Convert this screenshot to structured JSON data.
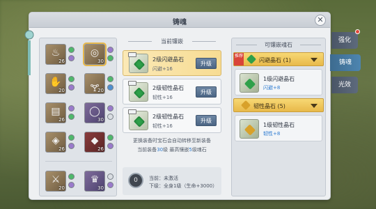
{
  "window": {
    "title": "铸魂",
    "close_glyph": "✕"
  },
  "equipment": [
    {
      "glyph": "♨",
      "lvl": "26",
      "color": "gold",
      "gems": [
        "g",
        "p"
      ]
    },
    {
      "glyph": "◎",
      "lvl": "30",
      "color": "gold",
      "gems": [
        "p",
        "g"
      ],
      "selected": true
    },
    {
      "glyph": "✋",
      "lvl": "20",
      "color": "gold",
      "gems": [
        "g",
        "p"
      ]
    },
    {
      "glyph": "🝖",
      "lvl": "20",
      "color": "gold",
      "gems": [
        "g",
        "b"
      ]
    },
    {
      "glyph": "▤",
      "lvl": "26",
      "color": "gold",
      "gems": [
        "p",
        "g"
      ]
    },
    {
      "glyph": "◯",
      "lvl": "30",
      "color": "purple",
      "gems": [
        "p",
        "e"
      ]
    },
    {
      "glyph": "◈",
      "lvl": "26",
      "color": "gold",
      "gems": [
        "g",
        "p"
      ]
    },
    {
      "glyph": "◆",
      "lvl": "26",
      "color": "red",
      "gems": [
        "g",
        "p"
      ]
    },
    {
      "glyph": "⚔",
      "lvl": "20",
      "color": "gold",
      "gems": [
        "g",
        "p"
      ]
    },
    {
      "glyph": "♛",
      "lvl": "30",
      "color": "purple",
      "gems": [
        "e",
        "p"
      ]
    }
  ],
  "current": {
    "header": "当前镶嵌",
    "slots": [
      {
        "name": "2级闪避晶石",
        "stat": "闪避+16",
        "button": "升级",
        "highlight": true,
        "color": "#2fa04a"
      },
      {
        "name": "2级韧性晶石",
        "stat": "韧性+16",
        "button": "升级",
        "highlight": false,
        "color": "#2fa04a"
      },
      {
        "name": "2级韧性晶石",
        "stat": "韧性+16",
        "button": "升级",
        "highlight": false,
        "color": "#2fa04a"
      }
    ],
    "note_line1": "更换装备时宝石会自动转移至新装备",
    "note_l2_a": "当前装备",
    "note_l2_num1": "30",
    "note_l2_b": "级 最高镶嵌",
    "note_l2_num2": "5",
    "note_l2_c": "级魂石",
    "soul": {
      "ring": "0",
      "line1": "当前：未激活",
      "line2": "下级：全身1级（生命+3000）"
    }
  },
  "available": {
    "header": "可镶嵌魂石",
    "recommend_badge": "推荐",
    "categories": [
      {
        "label": "闪避晶石 (1)",
        "color": "#2fa04a",
        "items": [
          {
            "name": "1级闪避晶石",
            "stat": "闪避+8",
            "color": "#2fa04a"
          }
        ]
      },
      {
        "label": "韧性晶石 (5)",
        "color": "#d8a12a",
        "items": [
          {
            "name": "1级韧性晶石",
            "stat": "韧性+8",
            "color": "#d8a12a"
          }
        ]
      }
    ]
  },
  "side_tabs": [
    "强化",
    "铸魂",
    "光效"
  ],
  "active_tab": "铸魂"
}
